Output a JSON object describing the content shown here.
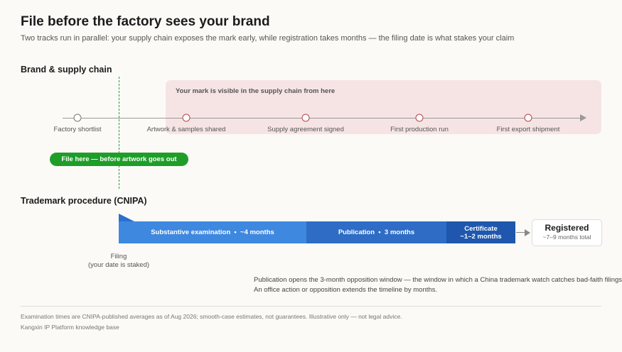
{
  "header": {
    "title": "File before the factory sees your brand",
    "subtitle": "Two tracks run in parallel: your supply chain exposes the mark early, while registration takes months — the filing date is what stakes your claim"
  },
  "supply_chain": {
    "heading": "Brand & supply chain",
    "exposure_label": "Your mark is visible in the supply chain from here",
    "milestones": [
      {
        "label": "Factory shortlist",
        "exposed": false
      },
      {
        "label": "Artwork & samples shared",
        "exposed": true
      },
      {
        "label": "Supply agreement signed",
        "exposed": true
      },
      {
        "label": "First production run",
        "exposed": true
      },
      {
        "label": "First export shipment",
        "exposed": true
      }
    ],
    "file_here_label": "File here — before artwork goes out"
  },
  "procedure": {
    "heading": "Trademark procedure (CNIPA)",
    "stages": [
      {
        "name": "Substantive examination",
        "duration": "~4 months"
      },
      {
        "name": "Publication",
        "duration": "3 months"
      },
      {
        "name": "Certificate",
        "duration": "~1–2 months"
      }
    ],
    "registered_title": "Registered",
    "registered_sub": "~7–9 months total",
    "filing_label_line1": "Filing",
    "filing_label_line2": "(your date is staked)",
    "note_line1": "Publication opens the 3-month opposition window — the window in which a China trademark watch catches bad-faith filings.",
    "note_line2": "An office action or opposition extends the timeline by months."
  },
  "footer": {
    "disclaimer": "Examination times are CNIPA-published averages as of Aug 2026; smooth-case estimates, not guarantees. Illustrative only — not legal advice.",
    "source": "Kangxin IP Platform knowledge base"
  },
  "colors": {
    "exposure_band": "#f6e4e4",
    "exposed_milestone": "#b8444a",
    "filing_green": "#1e9e29",
    "examination_blue": "#3e88e0",
    "publication_blue": "#2e6cc5",
    "certificate_blue": "#1e57ad"
  }
}
